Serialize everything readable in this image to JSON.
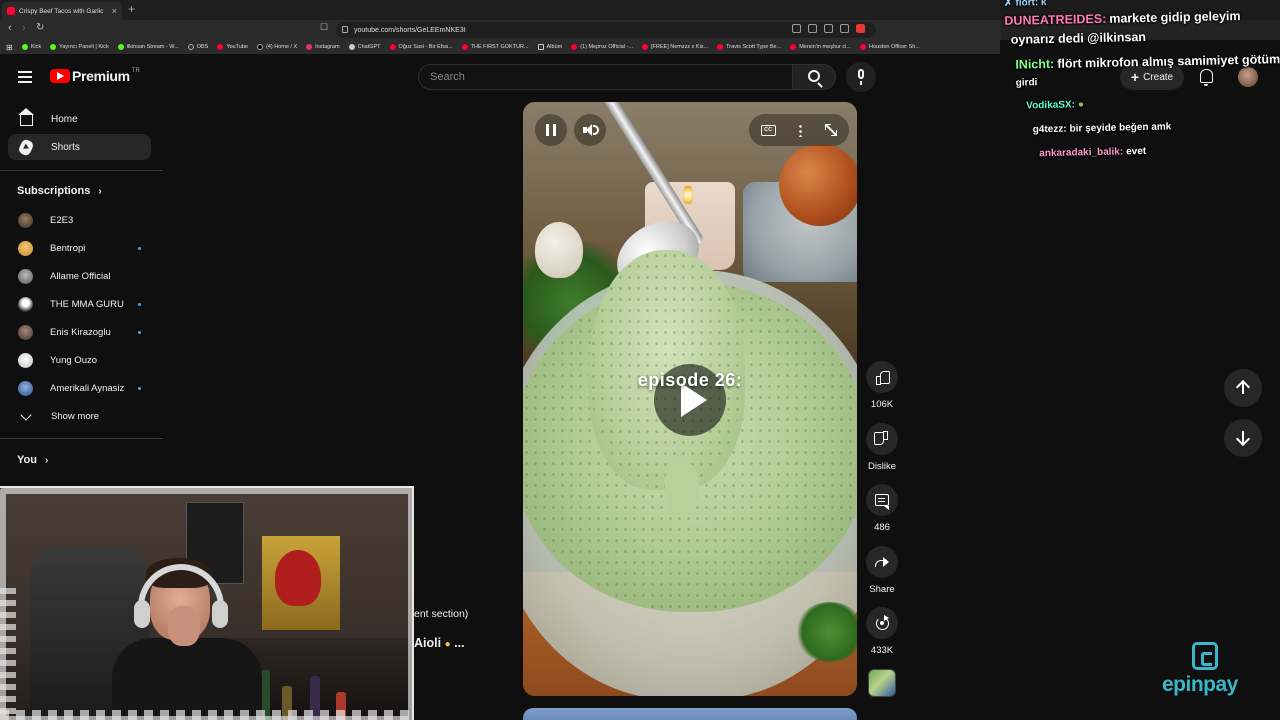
{
  "browser": {
    "tab_title": "Crispy Beef Tacos with Garlic",
    "url": "youtube.com/shorts/GeLEEmNKE3I",
    "bookmarks": [
      "Kick",
      "Yayıncı Paneli | Kick",
      "ilkinsan Stream - W...",
      "OBS",
      "YouTube",
      "(4) Home / X",
      "Instagram",
      "ChatGPT",
      "Oğuz Sasi - Bir Efsa...",
      "THE FIRST GOKTUR...",
      "Albüm",
      "(1) Meproz Official -...",
      "[FREE] Nemzzz x Kis...",
      "Travis Scott Type Be...",
      "Mersin'in meşhur ci...",
      "Houston Officer Sh..."
    ]
  },
  "youtube": {
    "logo_text": "Premium",
    "country_code": "TR",
    "search_placeholder": "Search",
    "create_label": "Create"
  },
  "sidebar": {
    "home_label": "Home",
    "shorts_label": "Shorts",
    "subscriptions_heading": "Subscriptions",
    "subscriptions": [
      {
        "name": "E2E3",
        "new": false,
        "color": "#5a4a3a"
      },
      {
        "name": "Bentropi",
        "new": true,
        "color": "#e0a64a"
      },
      {
        "name": "Allame Official",
        "new": false,
        "color": "#8a8a8a"
      },
      {
        "name": "THE MMA GURU",
        "new": true,
        "color": "#eeeeee"
      },
      {
        "name": "Enis Kirazoglu",
        "new": true,
        "color": "#6b5a50"
      },
      {
        "name": "Yung Ouzo",
        "new": false,
        "color": "#f0f0f0"
      },
      {
        "name": "Amerikali Aynasiz",
        "new": true,
        "color": "#4a6fa5"
      }
    ],
    "show_more_label": "Show more",
    "you_heading": "You"
  },
  "player": {
    "overlay_text": "episode 26:",
    "like_count": "106K",
    "dislike_label": "Dislike",
    "comment_count": "486",
    "share_label": "Share",
    "remix_count": "433K"
  },
  "description": {
    "fragment": "ent section)",
    "title_fragment": "Aioli",
    "title_ellipsis": "..."
  },
  "chat": {
    "messages": [
      {
        "user": "",
        "text": "flört: k",
        "color": "#9fd3ff"
      },
      {
        "user": "DUNEATREIDES:",
        "text": "markete gidip geleyim",
        "color": "#ff7ab6"
      },
      {
        "user": "",
        "text": "oynarız dedi @ilkinsan",
        "color": "#ffffff"
      },
      {
        "user": "INicht:",
        "text": "flört mikrofon almış samimiyet götümü",
        "color": "#7dff8a"
      },
      {
        "user": "",
        "text": "girdi",
        "color": "#ffffff"
      },
      {
        "user": "VodikaSX:",
        "text": "",
        "color": "#5effd0"
      },
      {
        "user": "g4tezz:",
        "text": "bir şeyide beğen amk",
        "color": "#ffffff"
      },
      {
        "user": "ankaradaki_balik:",
        "text": "evet",
        "color": "#ff9bc6"
      }
    ]
  },
  "sponsor": {
    "name": "epinpay",
    "color": "#39b7c9"
  }
}
